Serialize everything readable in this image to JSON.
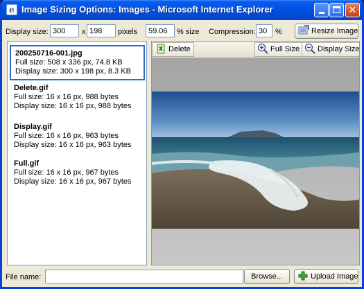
{
  "window": {
    "title": "Image Sizing Options: Images - Microsoft Internet Explorer",
    "icon": "ie-page-icon"
  },
  "toolbar": {
    "display_size_label": "Display size:",
    "width_value": "300",
    "times_label": "x",
    "height_value": "198",
    "pixels_label": "pixels",
    "percent_value": "59.06",
    "percent_label": "% size",
    "compression_label": "Compression:",
    "compression_value": "30",
    "compression_unit": "%",
    "resize_button": "Resize Image"
  },
  "files": [
    {
      "name": "200250716-001.jpg",
      "full": "Full size: 508 x 336 px, 74.8 KB",
      "display": "Display size: 300 x 198 px, 8.3 KB",
      "selected": true
    },
    {
      "name": "Delete.gif",
      "full": "Full size: 16 x 16 px, 988 bytes",
      "display": "Display size:  16 x 16 px, 988 bytes",
      "selected": false
    },
    {
      "name": "Display.gif",
      "full": "Full size: 16 x 16 px, 963 bytes",
      "display": "Display size:  16 x 16 px, 963 bytes",
      "selected": false
    },
    {
      "name": "Full.gif",
      "full": "Full size: 16 x 16 px, 967 bytes",
      "display": "Display size:  16 x 16 px, 967 bytes",
      "selected": false
    }
  ],
  "preview": {
    "delete_button": "Delete",
    "full_size_button": "Full Size",
    "display_size_button": "Display Size"
  },
  "footer": {
    "file_name_label": "File name:",
    "file_name_value": "",
    "browse_button": "Browse...",
    "upload_button": "Upload Image"
  }
}
